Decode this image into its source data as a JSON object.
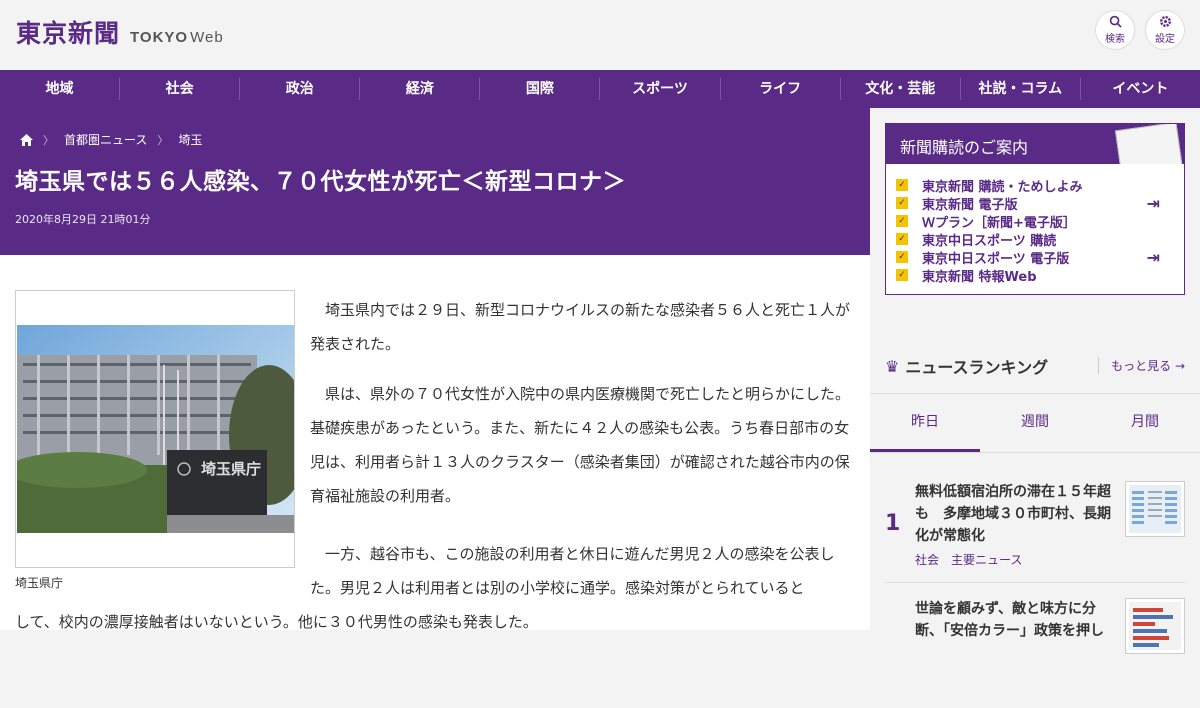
{
  "header": {
    "logo_jp": "東京新聞",
    "logo_en": "TOKYO",
    "logo_web": "Web",
    "search_label": "検索",
    "settings_label": "設定"
  },
  "nav": {
    "items": [
      "地域",
      "社会",
      "政治",
      "経済",
      "国際",
      "スポーツ",
      "ライフ",
      "文化・芸能",
      "社説・コラム",
      "イベント"
    ]
  },
  "breadcrumb": {
    "items": [
      "首都圏ニュース",
      "埼玉"
    ]
  },
  "article": {
    "title": "埼玉県では５６人感染、７０代女性が死亡＜新型コロナ＞",
    "date": "2020年8月29日 21時01分",
    "photo_sign": "埼玉県庁",
    "caption": "埼玉県庁",
    "paragraphs": [
      "埼玉県内では２９日、新型コロナウイルスの新たな感染者５６人と死亡１人が発表された。",
      "県は、県外の７０代女性が入院中の県内医療機関で死亡したと明らかにした。基礎疾患があったという。また、新たに４２人の感染も公表。うち春日部市の女児は、利用者ら計１３人のクラスター（感染者集団）が確認された越谷市内の保育福祉施設の利用者。",
      "一方、越谷市も、この施設の利用者と休日に遊んだ男児２人の感染を公表した。男児２人は利用者とは別の小学校に通学。感染対策がとられていると",
      "して、校内の濃厚接触者はいないという。他に３０代男性の感染も発表した。"
    ]
  },
  "promo": {
    "title": "新聞購読のご案内",
    "items": [
      "東京新聞 購読・ためしよみ",
      "東京新聞 電子版",
      "Ｗプラン［新聞+電子版］",
      "東京中日スポーツ 購読",
      "東京中日スポーツ 電子版",
      "東京新聞 特報Web"
    ]
  },
  "ranking": {
    "title": "ニュースランキング",
    "more": "もっと見る",
    "tabs": [
      "昨日",
      "週間",
      "月間"
    ],
    "items": [
      {
        "rank": "1",
        "title": "無料低額宿泊所の滞在１５年超も　多摩地域３０市町村、長期化が常態化",
        "tags": [
          "社会",
          "主要ニュース"
        ]
      },
      {
        "rank": "",
        "title": "世論を顧みず、敵と味方に分断、「安倍カラー」政策を押し",
        "tags": []
      }
    ]
  },
  "colors": {
    "brand": "#5a2a87",
    "accent": "#f5c400"
  }
}
